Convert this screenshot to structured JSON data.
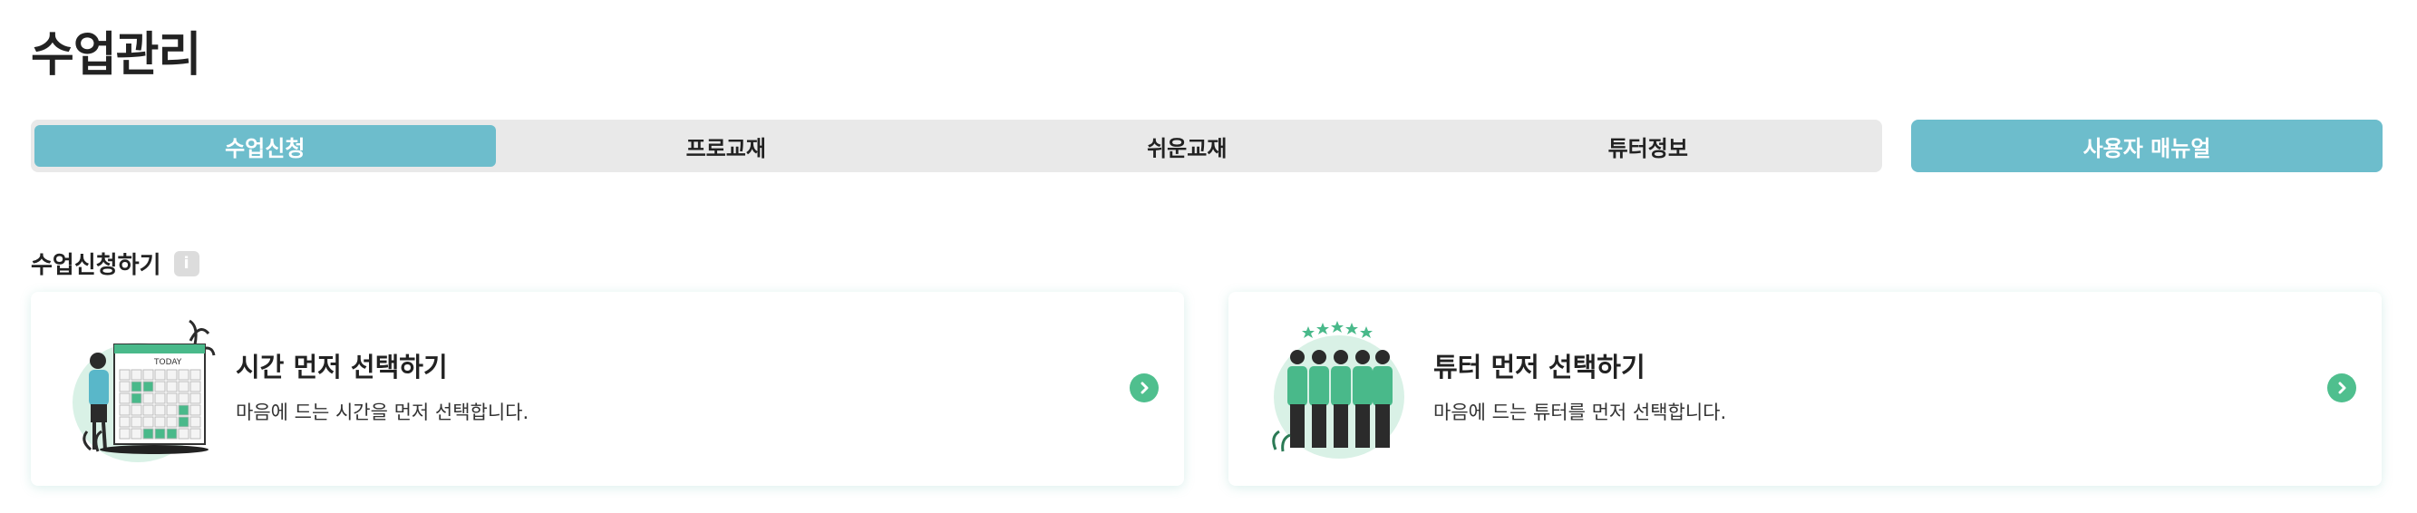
{
  "page": {
    "title": "수업관리"
  },
  "tabs": [
    {
      "label": "수업신청",
      "active": true
    },
    {
      "label": "프로교재",
      "active": false
    },
    {
      "label": "쉬운교재",
      "active": false
    },
    {
      "label": "튜터정보",
      "active": false
    }
  ],
  "manual_button": {
    "label": "사용자 매뉴얼"
  },
  "section": {
    "title": "수업신청하기",
    "info_icon": "info-icon"
  },
  "cards": [
    {
      "title": "시간 먼저 선택하기",
      "description": "마음에 드는 시간을 먼저 선택합니다.",
      "illustration": "calendar-illustration",
      "calendar_label": "TODAY"
    },
    {
      "title": "튜터 먼저 선택하기",
      "description": "마음에 드는 튜터를 먼저 선택합니다.",
      "illustration": "tutors-illustration"
    }
  ],
  "colors": {
    "accent": "#6dbdcc",
    "green": "#4fbf8e",
    "tab_bg": "#e9e9e9"
  }
}
